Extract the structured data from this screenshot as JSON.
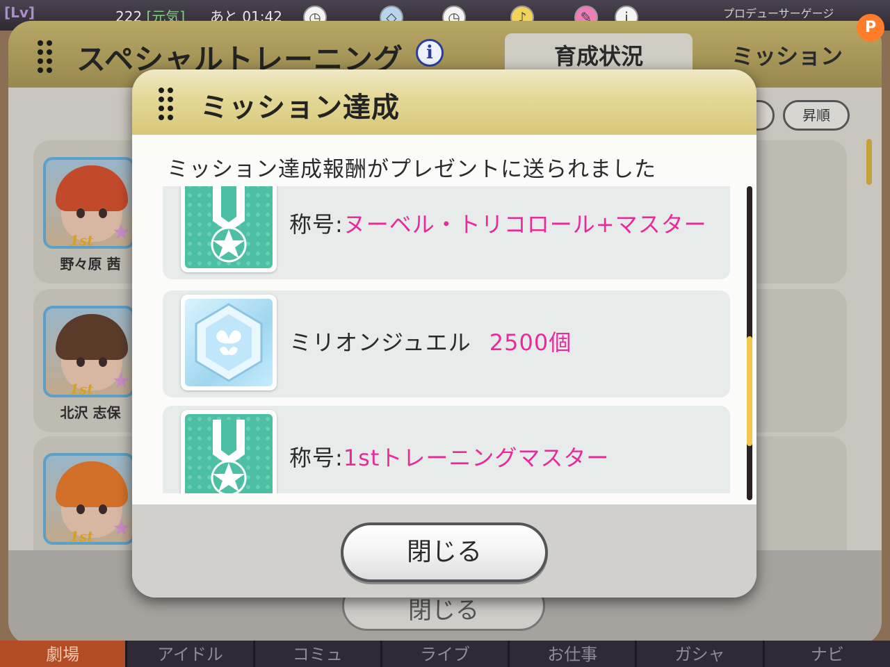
{
  "status_bar": {
    "lv": "[Lv]",
    "stamina_value": "222",
    "stamina_label": "[元気]",
    "recover_label": "あと 01:42",
    "producer_gauge": "プロデューサーゲージ",
    "p_badge": "P"
  },
  "background": {
    "title": "スペシャルトレーニング",
    "tabs": [
      "育成状況",
      "ミッション"
    ],
    "sort_order": "昇順",
    "idols": [
      {
        "name": "野々原 茜",
        "rank": "1st"
      },
      {
        "name": "北沢 志保",
        "rank": "1st"
      },
      {
        "name": "",
        "rank": "1st"
      }
    ],
    "close_label": "閉じる"
  },
  "modal": {
    "title": "ミッション達成",
    "message": "ミッション達成報酬がプレゼントに送られました",
    "rewards": [
      {
        "type": "title",
        "prefix": "称号:",
        "value": "ヌーベル・トリコロール+マスター",
        "icon": "medal-icon"
      },
      {
        "type": "item",
        "prefix": "ミリオンジュエル",
        "value": "2500個",
        "icon": "jewel-icon"
      },
      {
        "type": "title",
        "prefix": "称号:",
        "value": "1stトレーニングマスター",
        "icon": "medal-icon"
      }
    ],
    "close_label": "閉じる"
  },
  "bottom_nav": [
    "劇場",
    "アイドル",
    "コミュ",
    "ライブ",
    "お仕事",
    "ガシャ",
    "ナビ"
  ],
  "colors": {
    "accent_pink": "#ea2a9b",
    "header_gold": "#e5d99a",
    "medal_teal": "#4dc0a4",
    "scroll_thumb": "#f2c94c"
  }
}
